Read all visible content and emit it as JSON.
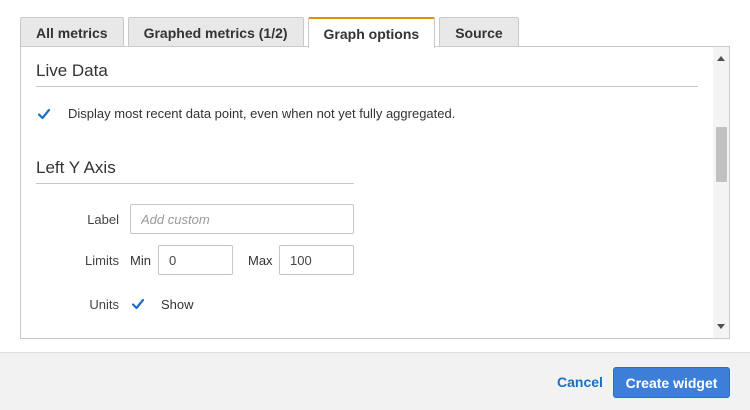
{
  "tabs": [
    {
      "label": "All metrics",
      "active": false
    },
    {
      "label": "Graphed metrics (1/2)",
      "active": false
    },
    {
      "label": "Graph options",
      "active": true
    },
    {
      "label": "Source",
      "active": false
    }
  ],
  "live_data": {
    "title": "Live Data",
    "checkbox_checked": true,
    "checkbox_label": "Display most recent data point, even when not yet fully aggregated."
  },
  "left_y_axis": {
    "title": "Left Y Axis",
    "label_field": {
      "label": "Label",
      "value": "",
      "placeholder": "Add custom"
    },
    "limits": {
      "label": "Limits",
      "min_label": "Min",
      "min_value": "0",
      "max_label": "Max",
      "max_value": "100"
    },
    "units": {
      "label": "Units",
      "checked": true,
      "checkbox_label": "Show"
    }
  },
  "footer": {
    "cancel_label": "Cancel",
    "create_label": "Create widget"
  },
  "colors": {
    "accent_tab": "#e48a1a",
    "primary_button": "#3d7fd8",
    "link": "#1a6fc0",
    "checkbox": "#1a6fc0"
  }
}
